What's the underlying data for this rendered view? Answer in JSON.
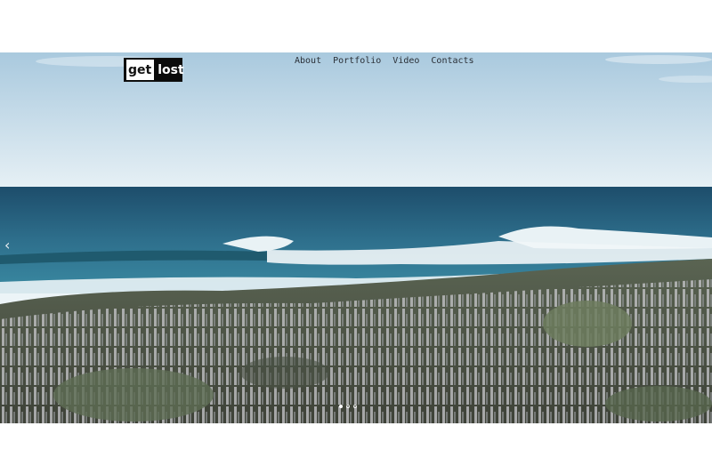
{
  "logo": {
    "part1": "get",
    "part2": "lost"
  },
  "nav": {
    "items": [
      {
        "label": "About"
      },
      {
        "label": "Portfolio"
      },
      {
        "label": "Video"
      },
      {
        "label": "Contacts"
      }
    ]
  },
  "slider": {
    "prev_icon": "chevron-left-icon",
    "prev_glyph": "‹",
    "slide_count": 3,
    "active_slide": 1
  },
  "colors": {
    "sky_top": "#a9c9de",
    "sky_bottom": "#e6f0f5",
    "ocean_dark": "#1d4d6b",
    "ocean_mid": "#2e7a95",
    "surf": "#f1f6f8",
    "vegetation": "#545a4c"
  }
}
